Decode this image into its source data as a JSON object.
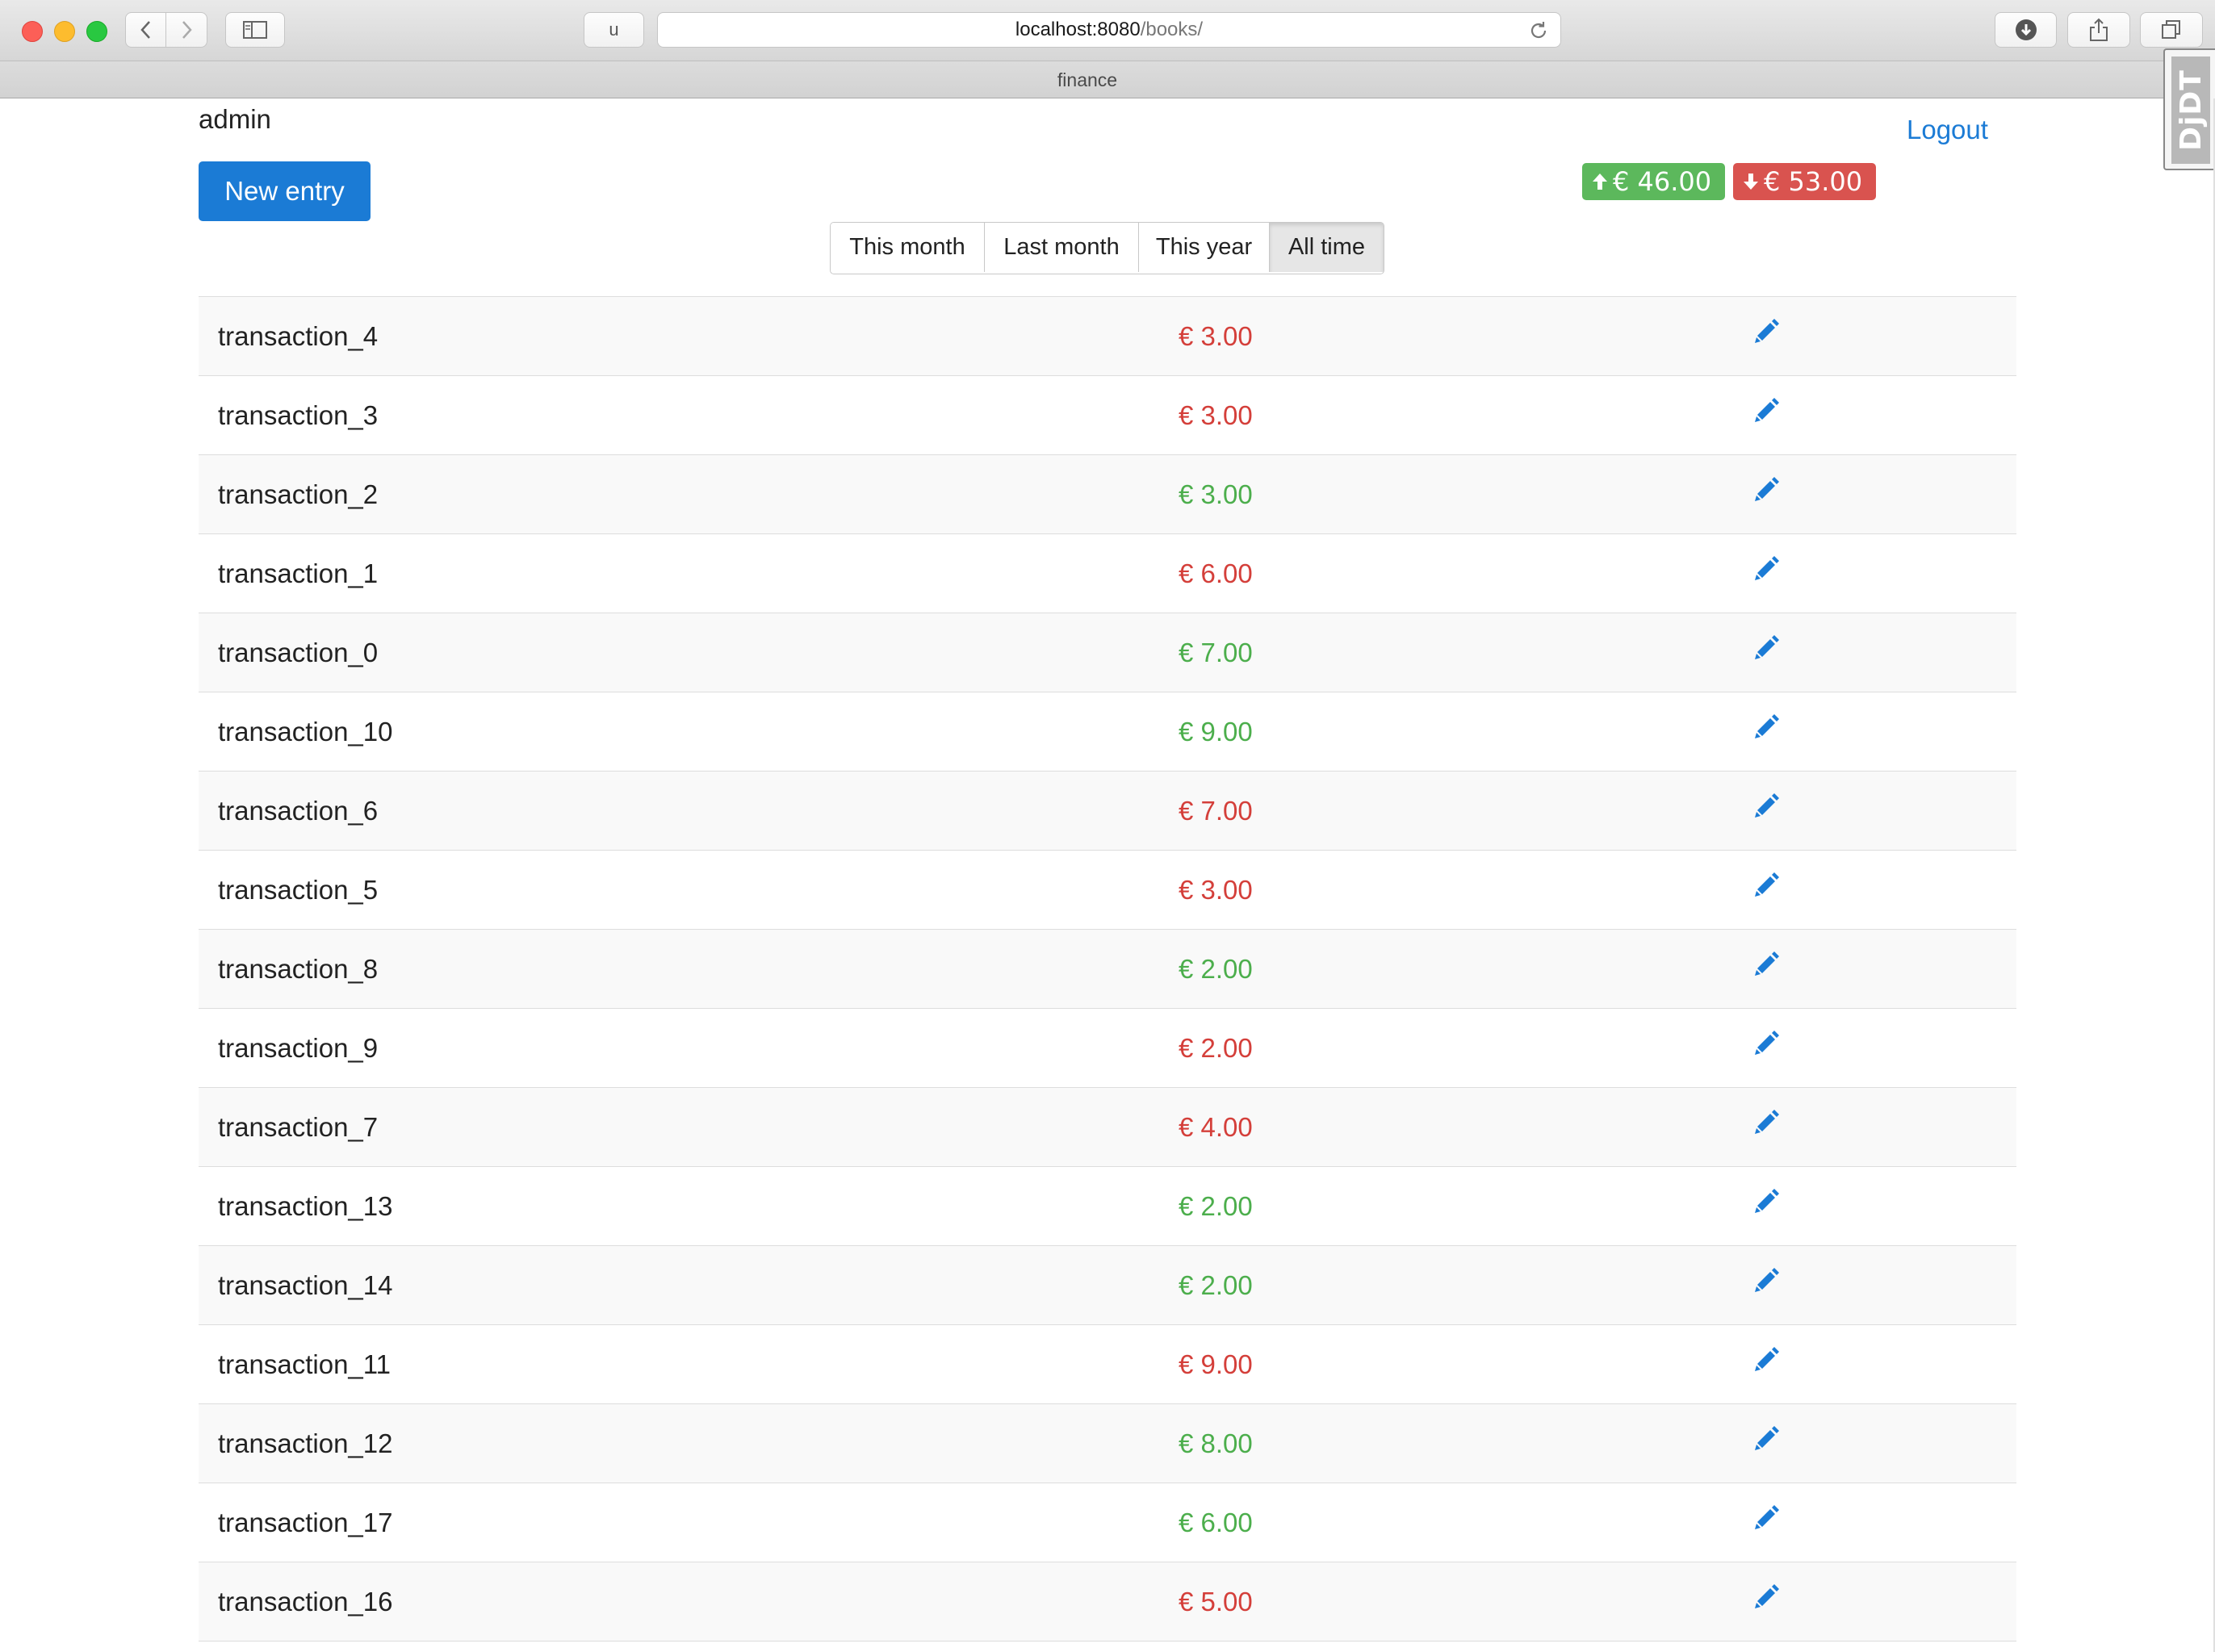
{
  "browser": {
    "reader_label": "u",
    "url_host": "localhost:8080",
    "url_path": "/books/",
    "tab_title": "finance"
  },
  "header": {
    "username": "admin",
    "logout_label": "Logout",
    "new_entry_label": "New entry",
    "income_total": "€ 46.00",
    "expense_total": "€ 53.00"
  },
  "periods": [
    {
      "label": "This month",
      "active": false
    },
    {
      "label": "Last month",
      "active": false
    },
    {
      "label": "This year",
      "active": false
    },
    {
      "label": "All time",
      "active": true
    }
  ],
  "transactions": [
    {
      "name": "transaction_4",
      "amount": "€ 3.00",
      "type": "expense"
    },
    {
      "name": "transaction_3",
      "amount": "€ 3.00",
      "type": "expense"
    },
    {
      "name": "transaction_2",
      "amount": "€ 3.00",
      "type": "income"
    },
    {
      "name": "transaction_1",
      "amount": "€ 6.00",
      "type": "expense"
    },
    {
      "name": "transaction_0",
      "amount": "€ 7.00",
      "type": "income"
    },
    {
      "name": "transaction_10",
      "amount": "€ 9.00",
      "type": "income"
    },
    {
      "name": "transaction_6",
      "amount": "€ 7.00",
      "type": "expense"
    },
    {
      "name": "transaction_5",
      "amount": "€ 3.00",
      "type": "expense"
    },
    {
      "name": "transaction_8",
      "amount": "€ 2.00",
      "type": "income"
    },
    {
      "name": "transaction_9",
      "amount": "€ 2.00",
      "type": "expense"
    },
    {
      "name": "transaction_7",
      "amount": "€ 4.00",
      "type": "expense"
    },
    {
      "name": "transaction_13",
      "amount": "€ 2.00",
      "type": "income"
    },
    {
      "name": "transaction_14",
      "amount": "€ 2.00",
      "type": "income"
    },
    {
      "name": "transaction_11",
      "amount": "€ 9.00",
      "type": "expense"
    },
    {
      "name": "transaction_12",
      "amount": "€ 8.00",
      "type": "income"
    },
    {
      "name": "transaction_17",
      "amount": "€ 6.00",
      "type": "income"
    },
    {
      "name": "transaction_16",
      "amount": "€ 5.00",
      "type": "expense"
    }
  ],
  "debug_toolbar": {
    "label": "DjDT"
  },
  "colors": {
    "accent": "#1b7bd5",
    "income": "#4cae4c",
    "expense": "#d43f3a",
    "income_badge": "#5cb85c",
    "expense_badge": "#d9534f"
  },
  "icons": [
    "chevron-left-icon",
    "chevron-right-icon",
    "sidebar-icon",
    "reload-icon",
    "download-icon",
    "share-icon",
    "tabs-icon",
    "plus-icon",
    "arrow-up-icon",
    "arrow-down-icon",
    "pencil-icon"
  ]
}
